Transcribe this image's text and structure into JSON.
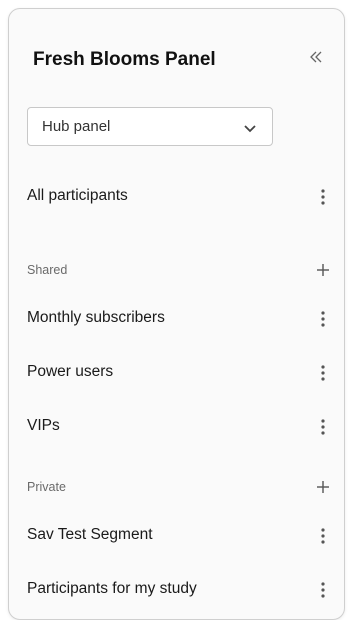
{
  "panel": {
    "title": "Fresh Blooms Panel",
    "collapse_icon": "double-chevron-left-icon"
  },
  "select": {
    "value": "Hub panel",
    "icon": "chevron-down-icon"
  },
  "all_participants": {
    "label": "All participants",
    "menu_icon": "kebab-menu-icon"
  },
  "sections": {
    "shared": {
      "label": "Shared",
      "add_icon": "plus-icon",
      "items": [
        {
          "label": "Monthly subscribers"
        },
        {
          "label": "Power users"
        },
        {
          "label": "VIPs"
        }
      ]
    },
    "private": {
      "label": "Private",
      "add_icon": "plus-icon",
      "items": [
        {
          "label": "Sav Test Segment"
        },
        {
          "label": "Participants for my study"
        }
      ]
    }
  },
  "colors": {
    "title": "#111111",
    "section_label": "#6a6a6a",
    "border": "#cfcfcf",
    "icon": "#555555"
  }
}
